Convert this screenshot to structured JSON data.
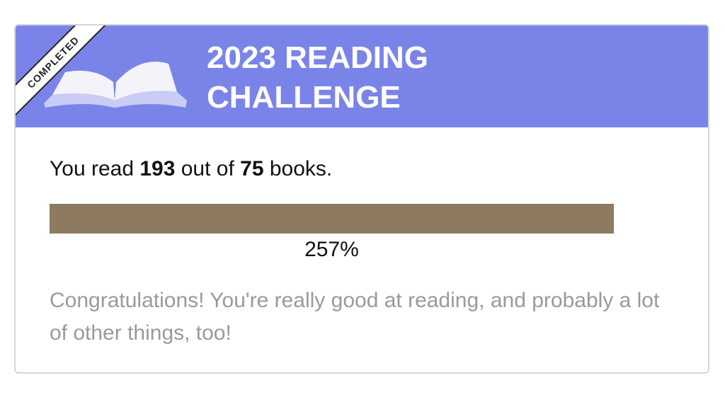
{
  "challenge": {
    "badge": "COMPLETED",
    "title_line1": "2023 READING",
    "title_line2": "CHALLENGE",
    "summary_prefix": "You read ",
    "books_read": "193",
    "summary_middle": " out of ",
    "goal": "75",
    "summary_suffix": " books.",
    "progress_percent_label": "257%",
    "progress_fraction": 2.57,
    "message": "Congratulations! You're really good at reading, and probably a lot of other things, too!"
  },
  "colors": {
    "header": "#7a84e8",
    "progress_fill": "#8d7a61",
    "message_text": "#9a9a9a"
  },
  "icons": {
    "book": "open-book-icon"
  }
}
